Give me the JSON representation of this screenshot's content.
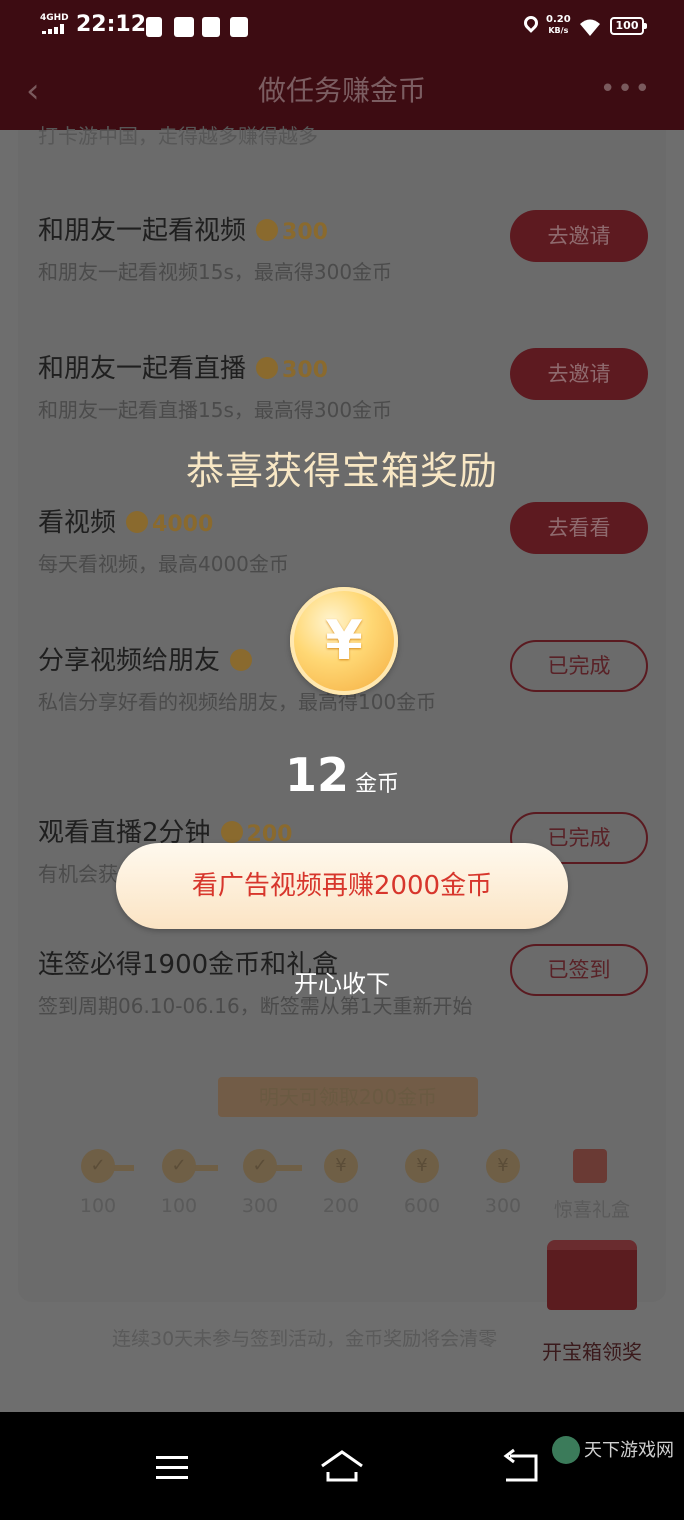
{
  "status_bar": {
    "network": "4GHD",
    "time": "22:12",
    "speed_value": "0.20",
    "speed_unit": "KB/s",
    "battery": "100"
  },
  "header": {
    "title": "做任务赚金币",
    "back_icon": "chevron-left-icon",
    "more_icon": "more-dots-icon"
  },
  "partial_desc": "打卡游中国，走得越多赚得越多",
  "tasks": [
    {
      "name": "和朋友一起看视频",
      "coins": "300",
      "desc": "和朋友一起看视频15s，最高得300金币",
      "button": "去邀请",
      "state": "todo"
    },
    {
      "name": "和朋友一起看直播",
      "coins": "300",
      "desc": "和朋友一起看直播15s，最高得300金币",
      "button": "去邀请",
      "state": "todo"
    },
    {
      "name": "看视频",
      "coins": "4000",
      "desc": "每天看视频，最高4000金币",
      "button": "去看看",
      "state": "todo"
    },
    {
      "name": "分享视频给朋友",
      "coins": "",
      "desc": "私信分享好看的视频给朋友，最高得100金币",
      "button": "已完成",
      "state": "done"
    },
    {
      "name": "观看直播2分钟",
      "coins": "200",
      "desc": "有机会获得",
      "button": "已完成",
      "state": "done"
    },
    {
      "name": "连签必得1900金币和礼盒",
      "coins": "",
      "desc": "签到周期06.10-06.16，断签需从第1天重新开始",
      "button": "已签到",
      "state": "done"
    }
  ],
  "checkin": {
    "tip": "明天可领取200金币",
    "days": [
      {
        "label": "100",
        "mark": "✓"
      },
      {
        "label": "100",
        "mark": "✓"
      },
      {
        "label": "300",
        "mark": "✓"
      },
      {
        "label": "200",
        "mark": "¥"
      },
      {
        "label": "600",
        "mark": "¥"
      },
      {
        "label": "300",
        "mark": "¥"
      },
      {
        "label": "惊喜礼盒",
        "mark": ""
      }
    ]
  },
  "bottom_note": "连续30天未参与签到活动，金币奖励将会清零",
  "chest_button": "开宝箱领奖",
  "modal": {
    "title": "恭喜获得宝箱奖励",
    "coin_symbol": "¥",
    "amount": "12",
    "unit": "金币",
    "ad_button": "看广告视频再赚2000金币",
    "accept_button": "开心收下"
  },
  "navbar": {
    "watermark": "天下游戏网"
  },
  "colors": {
    "header_bg": "#3d0c12",
    "modal_title": "#f8e7c4",
    "ad_text": "#d7362c",
    "ad_button_bg": "#fbe4c4"
  }
}
